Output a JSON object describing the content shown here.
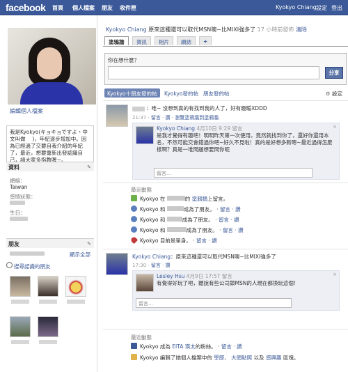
{
  "topbar": {
    "logo": "facebook",
    "nav": [
      "首頁",
      "個人檔案",
      "朋友",
      "收件匣"
    ],
    "user": "Kyokyo Chiang",
    "settings": "設定",
    "logout": "登出"
  },
  "left": {
    "edit_profile": "編輯個人檔案",
    "bio": "我是Kyokyo(キョキョですよ・中文叫做　 )，年紀逐步增加中。因為已經過了交要自我介紹的年紀了，最近，想要重新出發認識自己，請大家多指教喔~。",
    "info_title": "資料",
    "info": [
      {
        "label": "網絡：",
        "value": "Taiwan"
      },
      {
        "label": "感情狀態：",
        "value": ""
      },
      {
        "label": "生日：",
        "value": ""
      }
    ],
    "friends_title": "朋友",
    "friends_all": "顯示全部",
    "friends_search": "搜尋認識的朋友"
  },
  "main": {
    "status_name": "Kyokyo Chiang",
    "status_text": "原來這種還可以取代MSN噢~比MIXI強多了",
    "status_time": "17 小時前發佈",
    "status_clear": "清除",
    "tabs": [
      "塗鴉牆",
      "資訊",
      "相片",
      "網誌",
      "+"
    ],
    "composer_label": "你在想什麼？",
    "share": "分享",
    "filters": [
      "Kyokyo十朋友發的帖",
      "Kyokyo發的帖",
      "朋友發的帖"
    ],
    "filter_settings": "設定",
    "post1": {
      "text": "：唯~ 沒想到真的有找到我的人了，好有趣暖XDDD",
      "time": "21:37",
      "actions": "留言 · 讚 · 瀏覽塗鴉牆到塗鴉牆",
      "reply_name": "Kyokyo Chiang",
      "reply_time": "4月10日 9:29 留言",
      "reply_text": "是我才覺得有趣吧！明明昨天第一次使用，竟然就找到你了，還好你還用本名，不然可能交會錯過你吧~好久不見啦！真的是好想多新嗯~最近過得怎麼樣啊？真是一堆問題想要問你呢",
      "comment_placeholder": "留言..."
    },
    "recent1": {
      "title": "最近動態",
      "rows": [
        {
          "icon": "wall-icon",
          "pre": "Kyokyo 在",
          "post": "的",
          "link": "塗鴉牆",
          "tail": "上留言。"
        },
        {
          "icon": "friends-icon",
          "pre": "Kyokyo 和",
          "post": "成為了朋友。",
          "link": "留言",
          "tail": "· 讚"
        },
        {
          "icon": "friends-icon",
          "pre": "Kyokyo 和",
          "post": "成為了朋友。",
          "link": "留言",
          "tail": "· 讚"
        },
        {
          "icon": "friends-icon",
          "pre": "Kyokyo 和",
          "post": "成為了朋友。",
          "link": "留言",
          "tail": "· 讚"
        },
        {
          "icon": "single-icon",
          "pre": "Kyokyo 目前是單身。",
          "post": "",
          "link": "留言",
          "tail": "· 讚"
        }
      ]
    },
    "post2": {
      "name": "Kyokyo Chiang",
      "text": "：原來這種還可以取代MSN噢~比MIXI強多了",
      "time": "17:30",
      "actions": "留言 · 讚",
      "reply_name": "Lesley Hsu",
      "reply_time": "4月9日 17:57 留言",
      "reply_text": "有覺得好玩了吧，聽說有些公司鎖MSN的人現在都換玩這個!",
      "comment_placeholder": "留言..."
    },
    "recent2": {
      "title": "最近動態",
      "row1_pre": "Kyokyo 成為",
      "row1_link": "EITA 瑛太",
      "row1_post": "的粉絲。",
      "row1_actions": "留言 · 讚",
      "row2_pre": "Kyokyo 編輯了她個人檔案中的",
      "row2_links": [
        "學歷",
        "大頭貼照",
        "感興趣"
      ],
      "row2_mid": "、",
      "row2_and": "以及",
      "row2_post": "區塊。"
    }
  },
  "colors": {
    "brand": "#3b5998",
    "tab_bg": "#e9e9e9",
    "comment_bg": "#edeff4"
  }
}
